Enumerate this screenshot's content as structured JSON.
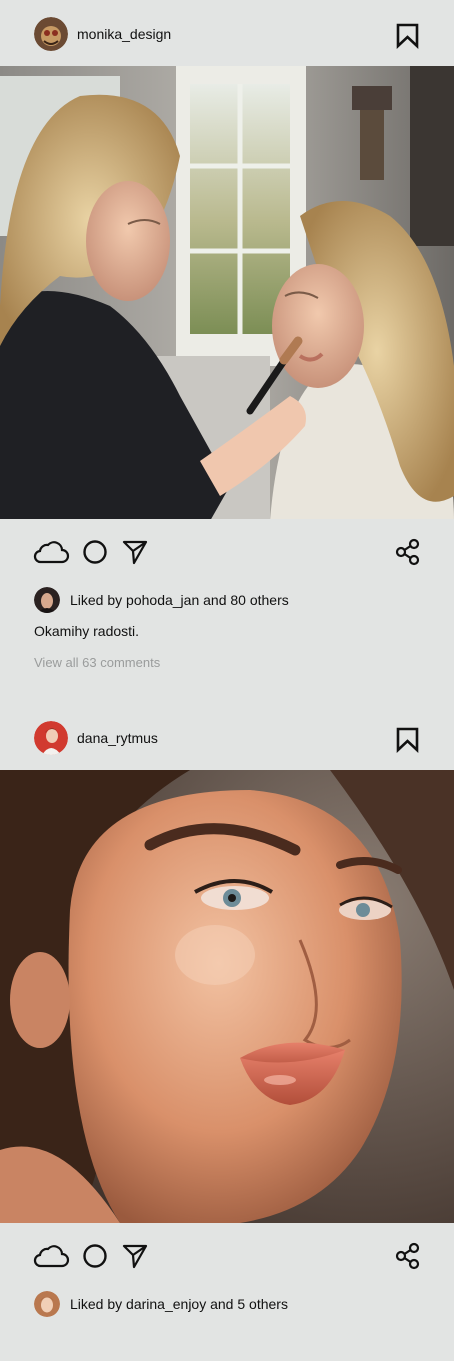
{
  "posts": [
    {
      "username": "monika_design",
      "liked_prefix": "Liked by",
      "liked_user": "pohoda_jan",
      "liked_suffix": "and 80 others",
      "caption": "Okamihy radosti.",
      "comments_link": "View all 63 comments"
    },
    {
      "username": "dana_rytmus",
      "liked_prefix": "Liked by",
      "liked_user": "darina_enjoy",
      "liked_suffix": "and 5 others"
    }
  ],
  "icons": {
    "like": "cloud-icon",
    "comment": "circle-icon",
    "send": "send-icon",
    "share": "share-icon",
    "save": "bookmark-icon"
  },
  "colors": {
    "background": "#e2e4e3",
    "text": "#111111",
    "muted": "#9a9c9c"
  }
}
